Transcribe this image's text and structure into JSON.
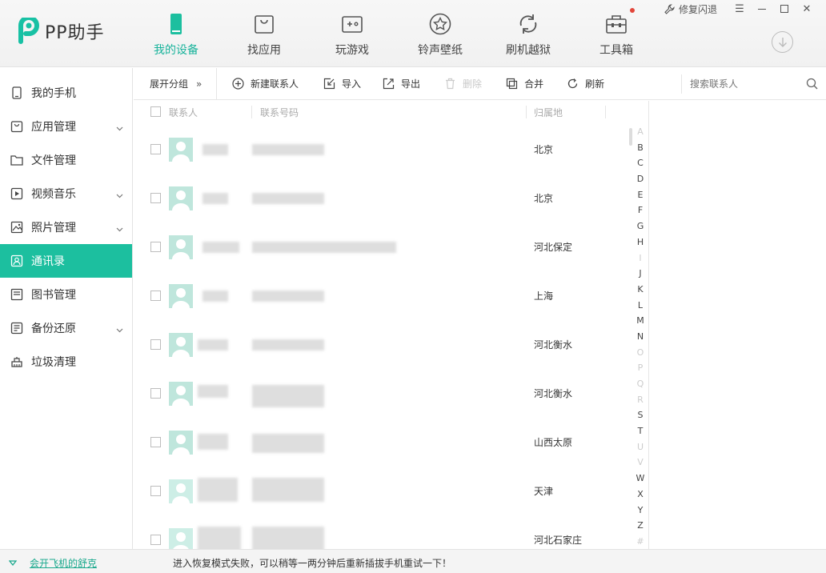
{
  "app": {
    "logo_text": "PP助手"
  },
  "nav": [
    {
      "label": "我的设备",
      "icon": "phone-icon"
    },
    {
      "label": "找应用",
      "icon": "bag-icon"
    },
    {
      "label": "玩游戏",
      "icon": "gamepad-icon"
    },
    {
      "label": "铃声壁纸",
      "icon": "star-icon"
    },
    {
      "label": "刷机越狱",
      "icon": "refresh-icon"
    },
    {
      "label": "工具箱",
      "icon": "toolbox-icon"
    }
  ],
  "window": {
    "repair_label": "修复闪退"
  },
  "sidebar": {
    "items": [
      {
        "label": "我的手机"
      },
      {
        "label": "应用管理"
      },
      {
        "label": "文件管理"
      },
      {
        "label": "视频音乐"
      },
      {
        "label": "照片管理"
      },
      {
        "label": "通讯录"
      },
      {
        "label": "图书管理"
      },
      {
        "label": "备份还原"
      },
      {
        "label": "垃圾清理"
      }
    ]
  },
  "toolbar": {
    "expand_group": "展开分组",
    "new_contact": "新建联系人",
    "import": "导入",
    "export": "导出",
    "delete": "删除",
    "merge": "合并",
    "refresh": "刷新",
    "search_placeholder": "搜索联系人"
  },
  "list": {
    "headers": {
      "contact": "联系人",
      "number": "联系号码",
      "location": "归属地"
    },
    "rows": [
      {
        "location": "北京"
      },
      {
        "location": "北京"
      },
      {
        "location": "河北保定"
      },
      {
        "location": "上海"
      },
      {
        "location": "河北衡水"
      },
      {
        "location": "河北衡水"
      },
      {
        "location": "山西太原"
      },
      {
        "location": "天津"
      },
      {
        "location": "河北石家庄"
      }
    ]
  },
  "alphabet": [
    "A",
    "B",
    "C",
    "D",
    "E",
    "F",
    "G",
    "H",
    "I",
    "J",
    "K",
    "L",
    "M",
    "N",
    "O",
    "P",
    "Q",
    "R",
    "S",
    "T",
    "U",
    "V",
    "W",
    "X",
    "Y",
    "Z",
    "#"
  ],
  "alphabet_dim": [
    "A",
    "I",
    "O",
    "P",
    "Q",
    "R",
    "U",
    "V",
    "#"
  ],
  "status": {
    "link": "会开飞机的舒克",
    "message": "进入恢复模式失败，可以稍等一两分钟后重新插拔手机重试一下！"
  },
  "colors": {
    "accent": "#1cbf9f",
    "avatar": "#bfe6dc"
  }
}
